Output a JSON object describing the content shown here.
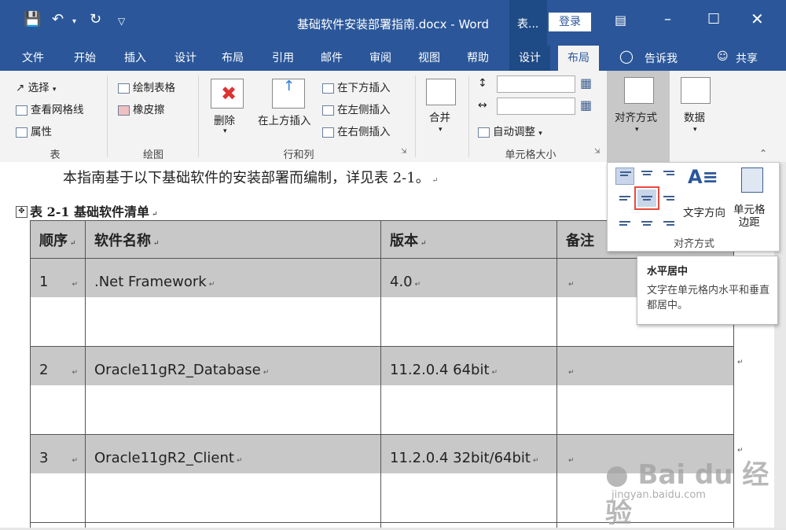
{
  "window": {
    "title": "基础软件安装部署指南.docx  -  Word",
    "table_tools_label": "表...",
    "login": "登录",
    "share": "共享",
    "tell_me": "告诉我"
  },
  "tabs": [
    "文件",
    "开始",
    "插入",
    "设计",
    "布局",
    "引用",
    "邮件",
    "审阅",
    "视图",
    "帮助"
  ],
  "context_tabs": [
    "设计",
    "布局"
  ],
  "ribbon": {
    "table_group": {
      "label": "表",
      "select": "选择",
      "view_gridlines": "查看网格线",
      "properties": "属性"
    },
    "draw_group": {
      "label": "绘图",
      "draw_table": "绘制表格",
      "eraser": "橡皮擦"
    },
    "rows_cols_group": {
      "label": "行和列",
      "delete": "删除",
      "insert_above": "在上方插入",
      "insert_below": "在下方插入",
      "insert_left": "在左侧插入",
      "insert_right": "在右侧插入"
    },
    "merge_group": {
      "label": "合并"
    },
    "cell_size_group": {
      "label": "单元格大小",
      "autofit": "自动调整"
    },
    "alignment": {
      "label": "对齐方式"
    },
    "data": {
      "label": "数据"
    }
  },
  "document": {
    "intro": "本指南基于以下基础软件的安装部署而编制，详见表 2-1。",
    "caption": "表  2-1  基础软件清单",
    "headers": [
      "顺序",
      "软件名称",
      "版本",
      "备注"
    ],
    "rows": [
      [
        "1",
        ".Net Framework",
        "4.0",
        ""
      ],
      [
        "2",
        "Oracle11gR2_Database",
        "11.2.0.4 64bit",
        ""
      ],
      [
        "3",
        "Oracle11gR2_Client",
        "11.2.0.4 32bit/64bit",
        ""
      ]
    ]
  },
  "dropdown": {
    "text_direction": "文字方向",
    "cell_margins": "单元格\n边距",
    "footer": "对齐方式"
  },
  "tooltip": {
    "title": "水平居中",
    "body": "文字在单元格内水平和垂直都居中。"
  },
  "watermark": {
    "brand": "Bai du 经验",
    "url": "jingyan.baidu.com"
  },
  "colors": {
    "accent": "#2b579a",
    "row_fill": "#c8c8c8",
    "highlight": "#e84a3c"
  }
}
